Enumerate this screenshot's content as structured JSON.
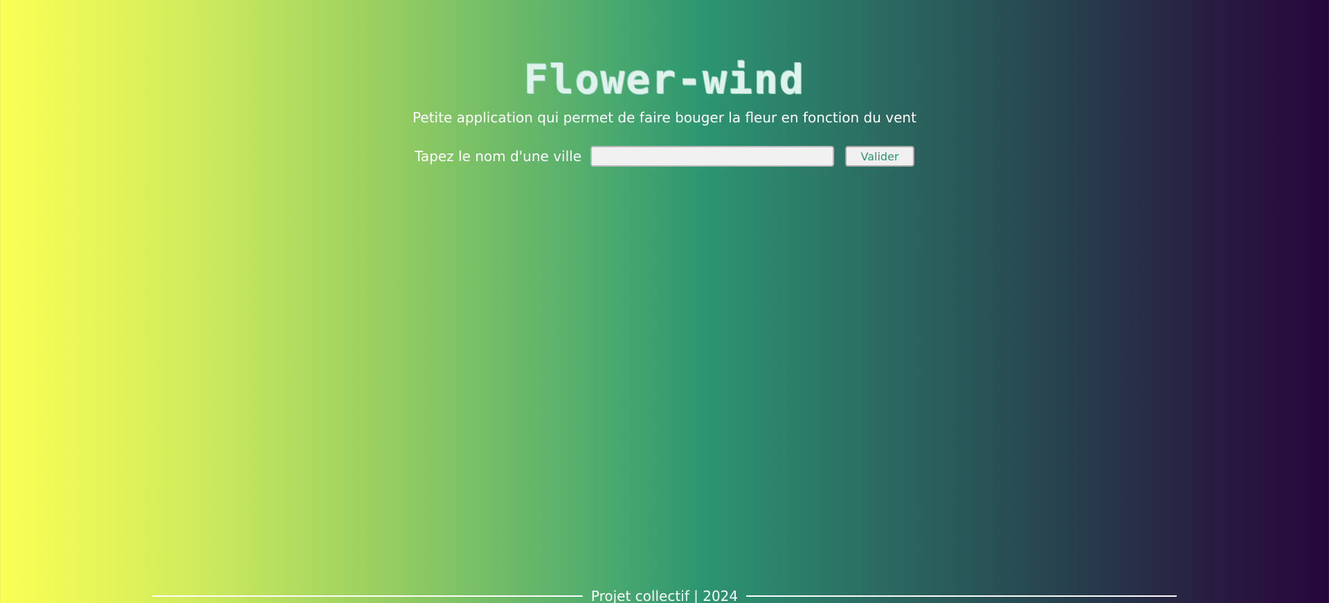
{
  "header": {
    "title": "Flower-wind",
    "subtitle": "Petite application qui permet de faire bouger la fleur en fonction du vent"
  },
  "form": {
    "label": "Tapez le nom d'une ville",
    "input_value": "",
    "submit_label": "Valider"
  },
  "footer": {
    "text": "Projet collectif | 2024"
  },
  "colors": {
    "gradient_left": "#fbff55",
    "gradient_mid": "#2c9571",
    "gradient_right": "#27053d",
    "button_text": "#2c9571"
  }
}
